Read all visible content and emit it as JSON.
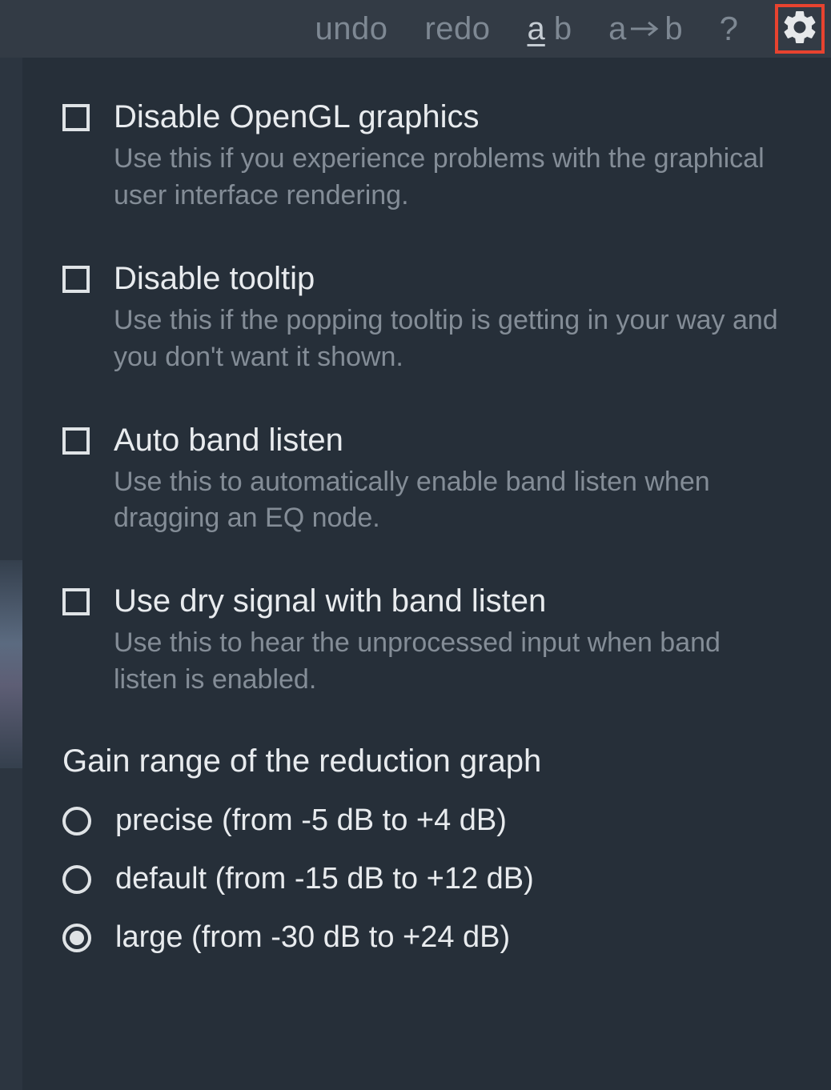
{
  "toolbar": {
    "undo": "undo",
    "redo": "redo",
    "ab_a": "a",
    "ab_b": "b",
    "ab_arrow_a": "a",
    "ab_arrow_b": "b",
    "help": "?"
  },
  "options": [
    {
      "title": "Disable OpenGL graphics",
      "desc": "Use this if you experience problems with the graphical user interface rendering.",
      "checked": false
    },
    {
      "title": "Disable tooltip",
      "desc": "Use this if the popping tooltip is getting in your way and you don't want it shown.",
      "checked": false
    },
    {
      "title": "Auto band listen",
      "desc": "Use this to automatically enable band listen when dragging an EQ node.",
      "checked": false
    },
    {
      "title": "Use dry signal with band listen",
      "desc": "Use this to hear the unprocessed input when band listen is enabled.",
      "checked": false
    }
  ],
  "gain_section": {
    "heading": "Gain range of the reduction graph",
    "options": [
      {
        "label": "precise (from -5 dB to +4 dB)",
        "selected": false
      },
      {
        "label": "default (from -15 dB to +12 dB)",
        "selected": false
      },
      {
        "label": "large (from -30 dB to +24 dB)",
        "selected": true
      }
    ]
  }
}
